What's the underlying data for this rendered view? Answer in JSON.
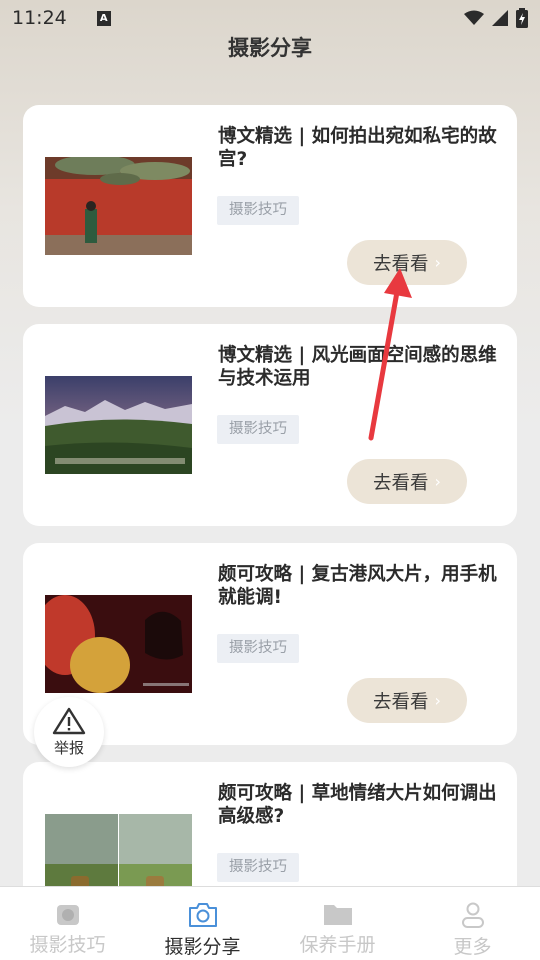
{
  "status_bar": {
    "time": "11:24",
    "notification_icon": "A"
  },
  "header": {
    "title": "摄影分享"
  },
  "cards": [
    {
      "title": "博文精选 | 如何拍出宛如私宅的故宫?",
      "tag": "摄影技巧",
      "button_label": "去看看"
    },
    {
      "title": "博文精选 | 风光画面空间感的思维与技术运用",
      "tag": "摄影技巧",
      "button_label": "去看看"
    },
    {
      "title": "颇可攻略 | 复古港风大片，用手机就能调!",
      "tag": "摄影技巧",
      "button_label": "去看看"
    },
    {
      "title": "颇可攻略 | 草地情绪大片如何调出高级感?",
      "tag": "摄影技巧",
      "button_label": "去看看"
    }
  ],
  "report": {
    "label": "举报"
  },
  "bottom_nav": [
    {
      "label": "摄影技巧",
      "icon": "camera-filled-icon"
    },
    {
      "label": "摄影分享",
      "icon": "camera-outline-icon",
      "active": true
    },
    {
      "label": "保养手册",
      "icon": "folder-icon"
    },
    {
      "label": "更多",
      "icon": "person-icon"
    }
  ],
  "colors": {
    "accent": "#4a90d9",
    "button_bg": "#ece4d7",
    "annotation_arrow": "#e8393f"
  }
}
